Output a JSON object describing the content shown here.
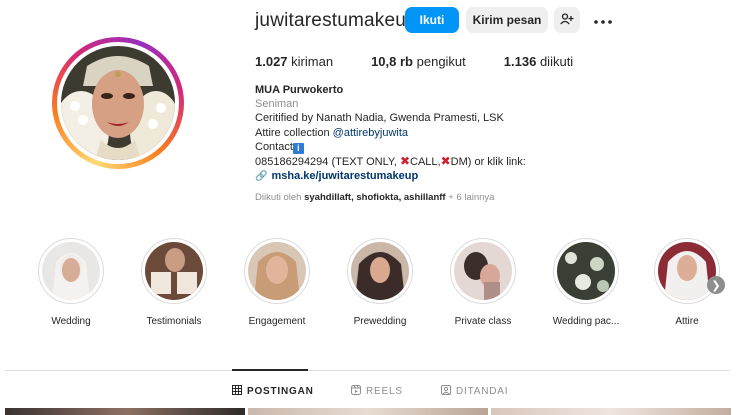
{
  "profile": {
    "username": "juwitarestumakeup",
    "follow_label": "Ikuti",
    "message_label": "Kirim pesan",
    "suggest_icon": "person-add-icon",
    "more_icon": "more-dots-icon"
  },
  "stats": {
    "posts_count": "1.027",
    "posts_label": "kiriman",
    "followers_count": "10,8 rb",
    "followers_label": "pengikut",
    "following_count": "1.136",
    "following_label": "diikuti"
  },
  "bio": {
    "name": "MUA Purwokerto",
    "category": "Seniman",
    "line1": "Ceritified by Nanath Nadia, Gwenda Pramesti, LSK",
    "line2_prefix": "Attire collection ",
    "line2_tag": "@attirebyjuwita",
    "line3": "Contact",
    "line3_badge": "i",
    "line4_a": "085186294294 (TEXT ONLY, ",
    "line4_x": "✖",
    "line4_b": "CALL,",
    "line4_c": "DM) or klik link:",
    "link": "msha.ke/juwitarestumakeup"
  },
  "followed_by": {
    "prefix": "Diikuti oleh ",
    "names": "syahdillaft, shofiokta, ashillanff",
    "suffix": " + 6 lainnya"
  },
  "highlights": [
    {
      "label": "Wedding"
    },
    {
      "label": "Testimonials"
    },
    {
      "label": "Engagement"
    },
    {
      "label": "Prewedding"
    },
    {
      "label": "Private class"
    },
    {
      "label": "Wedding pac..."
    },
    {
      "label": "Attire"
    }
  ],
  "tabs": {
    "posts": "POSTINGAN",
    "reels": "REELS",
    "tagged": "DITANDAI"
  },
  "colors": {
    "accent": "#0095f6",
    "text": "#262626",
    "muted": "#8e8e8e"
  }
}
